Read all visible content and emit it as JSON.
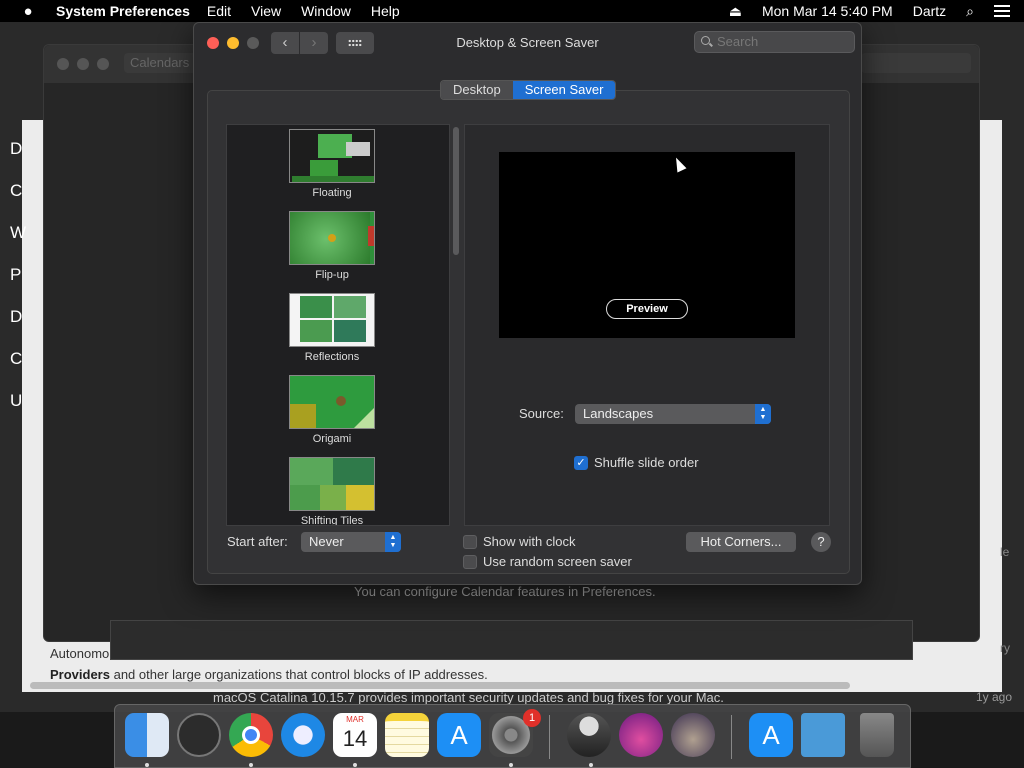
{
  "menubar": {
    "apple": "",
    "app_name": "System Preferences",
    "menus": [
      "Edit",
      "View",
      "Window",
      "Help"
    ],
    "datetime": "Mon Mar 14  5:40 PM",
    "user": "Dartz"
  },
  "background": {
    "calendar_tab": "Calendars",
    "calendar_hint": "You can configure Calendar features in Preferences.",
    "left_letters": [
      "D",
      "C",
      "W",
      "P",
      "D",
      "C",
      "U"
    ],
    "bottom_line1": "Autonomo",
    "bottom_line2_bold": "Providers",
    "bottom_line2_rest": " and other large organizations that control blocks of IP addresses.",
    "update_text": "macOS Catalina 10.15.7 provides important security updates and bug fixes for your Mac.",
    "right_text": [
      "le",
      "",
      "",
      "ry"
    ],
    "ago": "1y ago"
  },
  "window": {
    "title": "Desktop & Screen Saver",
    "search_placeholder": "Search",
    "tabs": [
      {
        "label": "Desktop",
        "active": false
      },
      {
        "label": "Screen Saver",
        "active": true
      }
    ]
  },
  "screensavers": [
    {
      "label": "Floating"
    },
    {
      "label": "Flip-up"
    },
    {
      "label": "Reflections"
    },
    {
      "label": "Origami"
    },
    {
      "label": "Shifting Tiles"
    }
  ],
  "preview": {
    "button": "Preview",
    "source_label": "Source:",
    "source_value": "Landscapes",
    "shuffle_label": "Shuffle slide order",
    "shuffle_checked": true
  },
  "footer": {
    "start_after_label": "Start after:",
    "start_after_value": "Never",
    "show_clock_label": "Show with clock",
    "show_clock_checked": false,
    "random_label": "Use random screen saver",
    "random_checked": false,
    "hot_corners": "Hot Corners...",
    "help": "?"
  },
  "dock": {
    "calendar_day": "14",
    "calendar_month": "MAR",
    "system_prefs_badge": "1",
    "app_store_glyph": "A"
  },
  "colors": {
    "accent": "#1f6fd1",
    "close": "#fe5f57",
    "minimize": "#febc2e"
  }
}
